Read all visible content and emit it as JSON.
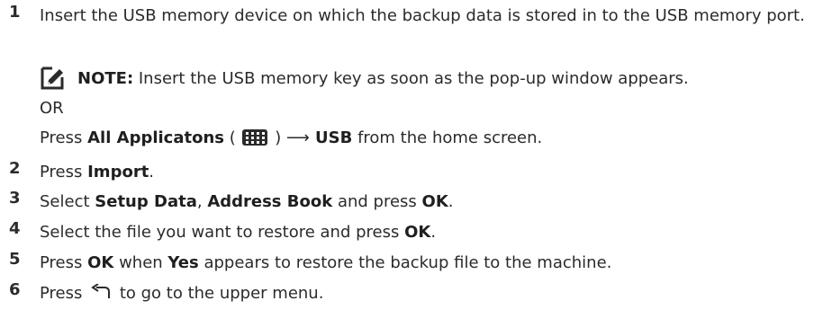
{
  "steps": [
    {
      "num": "1",
      "text": "Insert the USB memory device on which the backup data is stored in to the USB memory port."
    },
    {
      "num": "2",
      "pre": "Press ",
      "b1": "Import",
      "post": "."
    },
    {
      "num": "3",
      "pre": "Select ",
      "b1": "Setup Data",
      "mid": ", ",
      "b2": "Address Book",
      "mid2": " and press ",
      "b3": "OK",
      "post": "."
    },
    {
      "num": "4",
      "pre": "Select the file you want to restore and press ",
      "b1": "OK",
      "post": "."
    },
    {
      "num": "5",
      "pre": "Press ",
      "b1": "OK",
      "mid": " when ",
      "b2": "Yes",
      "post": " appears to restore the backup file to the machine."
    },
    {
      "num": "6",
      "pre": "Press ",
      "icon": "back-arrow-icon",
      "post": " to go to the upper menu."
    }
  ],
  "note": {
    "icon": "note-pencil-icon",
    "label": "NOTE:",
    "text": " Insert the USB memory key as soon as the pop-up window appears."
  },
  "or_text": "OR",
  "alt_line": {
    "pre": "Press ",
    "b1": "All Applicatons",
    "paren_open": " ( ",
    "icon": "all-apps-grid-icon",
    "paren_close": " ) ",
    "arrow": "⟶",
    "b2": " USB",
    "post": " from the home screen."
  },
  "colors": {
    "text": "#2b2b2b",
    "icon": "#2b2b2b"
  }
}
